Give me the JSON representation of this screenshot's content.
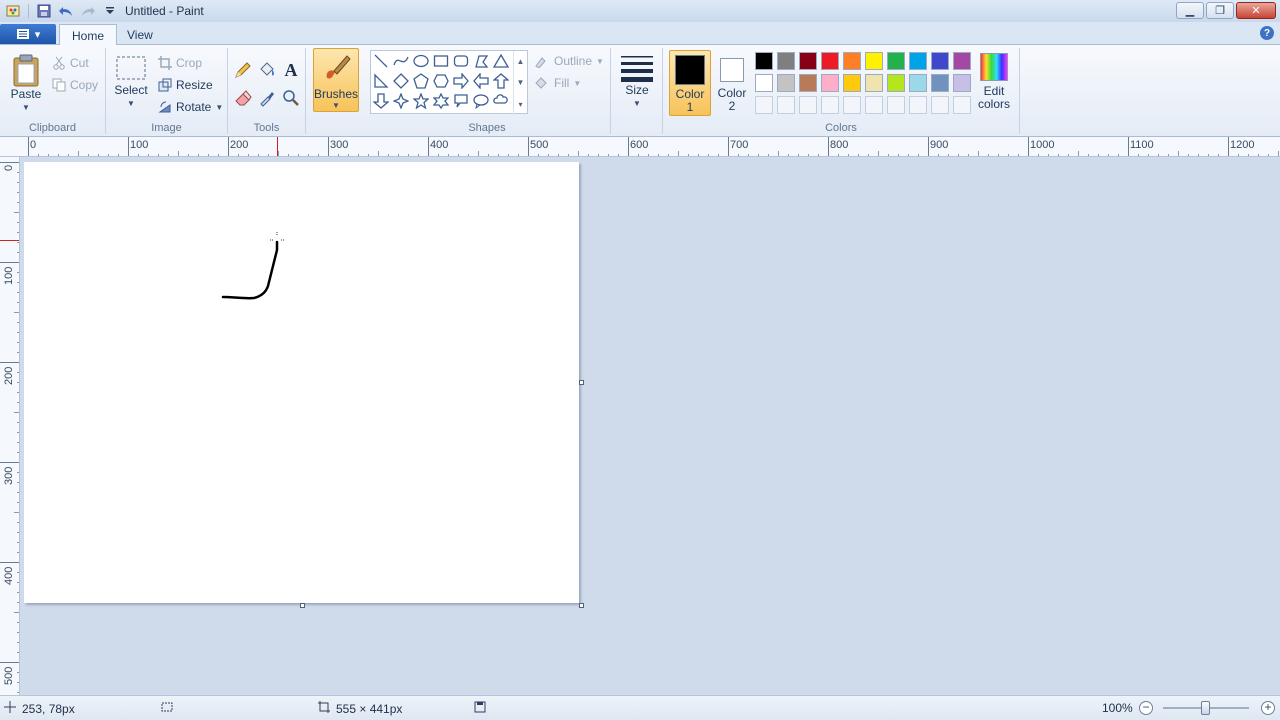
{
  "window": {
    "title": "Untitled - Paint",
    "minimize_icon": "minimize-icon",
    "maximize_icon": "restore-icon",
    "close_icon": "close-icon"
  },
  "quick_access": {
    "items": [
      "save-icon",
      "undo-icon",
      "redo-icon",
      "customize-dropdown-icon"
    ]
  },
  "tabs": [
    {
      "label": "Home",
      "active": true
    },
    {
      "label": "View",
      "active": false
    }
  ],
  "help_label": "?",
  "ribbon": {
    "clipboard": {
      "label": "Clipboard",
      "paste": "Paste",
      "cut": "Cut",
      "copy": "Copy"
    },
    "image": {
      "label": "Image",
      "select": "Select",
      "crop": "Crop",
      "resize": "Resize",
      "rotate": "Rotate"
    },
    "tools": {
      "label": "Tools",
      "text_glyph": "A"
    },
    "brushes": {
      "label": "Brushes"
    },
    "shapes": {
      "label": "Shapes",
      "outline": "Outline",
      "fill": "Fill"
    },
    "size": {
      "label": "Size"
    },
    "colors": {
      "label": "Colors",
      "color1_line1": "Color",
      "color1_line2": "1",
      "color2_line1": "Color",
      "color2_line2": "2",
      "edit_line1": "Edit",
      "edit_line2": "colors",
      "color1_value": "#000000",
      "color2_value": "#ffffff",
      "palette_row1": [
        "#000000",
        "#7f7f7f",
        "#880015",
        "#ed1c24",
        "#ff7f27",
        "#fff200",
        "#22b14c",
        "#00a2e8",
        "#3f48cc",
        "#a349a4"
      ],
      "palette_row2": [
        "#ffffff",
        "#c3c3c3",
        "#b97a57",
        "#ffaec9",
        "#ffc90e",
        "#efe4b0",
        "#b5e61d",
        "#99d9ea",
        "#7092be",
        "#c8bfe7"
      ]
    }
  },
  "ruler": {
    "h_labels": [
      "0",
      "100",
      "200",
      "300",
      "400",
      "500",
      "600",
      "700",
      "800",
      "900",
      "1000",
      "1100",
      "1200"
    ],
    "v_labels": [
      "0",
      "100",
      "200",
      "300",
      "400",
      "500"
    ]
  },
  "status": {
    "cursor_pos": "253, 78px",
    "canvas_size": "555 × 441px",
    "zoom": "100%",
    "zoom_level": 1.0
  }
}
